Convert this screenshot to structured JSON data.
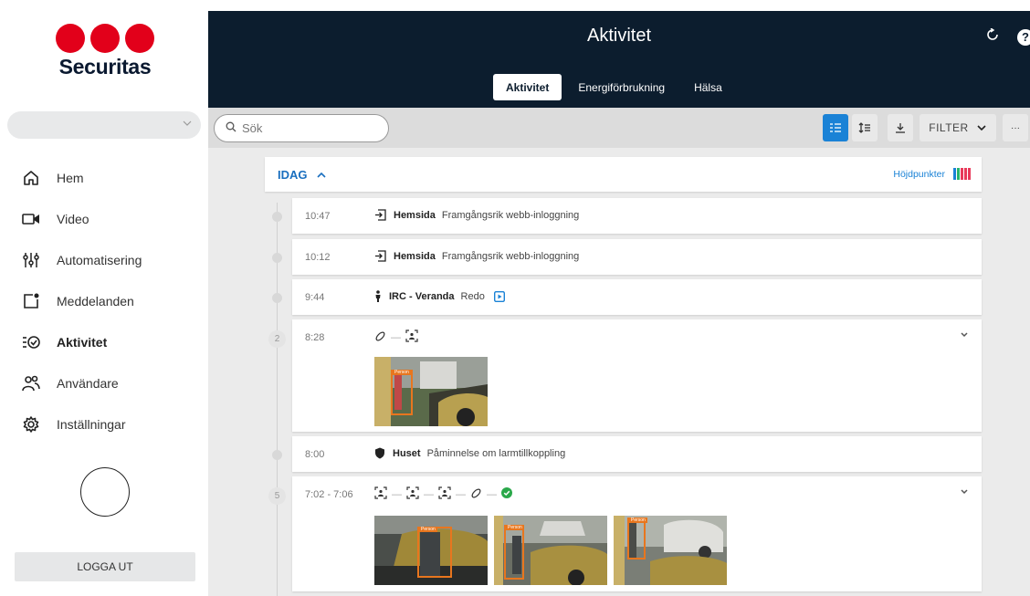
{
  "brand": {
    "name": "Securitas",
    "dot_color": "#e2001a"
  },
  "sidebar": {
    "items": [
      {
        "label": "Hem",
        "icon": "home-icon"
      },
      {
        "label": "Video",
        "icon": "video-camera-icon"
      },
      {
        "label": "Automatisering",
        "icon": "sliders-icon"
      },
      {
        "label": "Meddelanden",
        "icon": "message-notification-icon"
      },
      {
        "label": "Aktivitet",
        "icon": "activity-icon",
        "active": true
      },
      {
        "label": "Användare",
        "icon": "users-icon"
      },
      {
        "label": "Inställningar",
        "icon": "gear-icon"
      }
    ],
    "logout_label": "LOGGA UT"
  },
  "header": {
    "title": "Aktivitet",
    "tabs": [
      {
        "label": "Aktivitet",
        "active": true
      },
      {
        "label": "Energiförbrukning"
      },
      {
        "label": "Hälsa"
      }
    ],
    "help_glyph": "?"
  },
  "toolbar": {
    "search_placeholder": "Sök",
    "filter_label": "FILTER",
    "more_label": "···"
  },
  "feed": {
    "day_label": "IDAG",
    "highlights_label": "Höjdpunkter",
    "highlight_colors": [
      "#1a82d6",
      "#27b36b",
      "#e83a5a",
      "#e83a5a",
      "#e83a5a"
    ],
    "events": [
      {
        "time": "10:47",
        "icon": "login-icon",
        "source": "Hemsida",
        "text": "Framgångsrik webb-inloggning"
      },
      {
        "time": "10:12",
        "icon": "login-icon",
        "source": "Hemsida",
        "text": "Framgångsrik webb-inloggning"
      },
      {
        "time": "9:44",
        "icon": "person-icon",
        "source": "IRC - Veranda",
        "text": "Redo",
        "extra_icon": "video-clip-icon"
      },
      {
        "time": "8:28",
        "badge": "2",
        "sequence": [
          "motion-sensor-icon",
          "person-detected-icon"
        ],
        "thumbnails": 1
      },
      {
        "time": "8:00",
        "icon": "shield-icon",
        "source": "Huset",
        "text": "Påminnelse om larmtillkoppling"
      },
      {
        "time": "7:02 - 7:06",
        "badge": "5",
        "sequence": [
          "person-detected-icon",
          "person-detected-icon",
          "person-detected-icon",
          "motion-sensor-icon",
          "check-circle-icon"
        ],
        "thumbnails": 3
      }
    ],
    "detection_label": "Person",
    "accent_color": "#1a82d6",
    "detection_color": "#e8761e"
  }
}
